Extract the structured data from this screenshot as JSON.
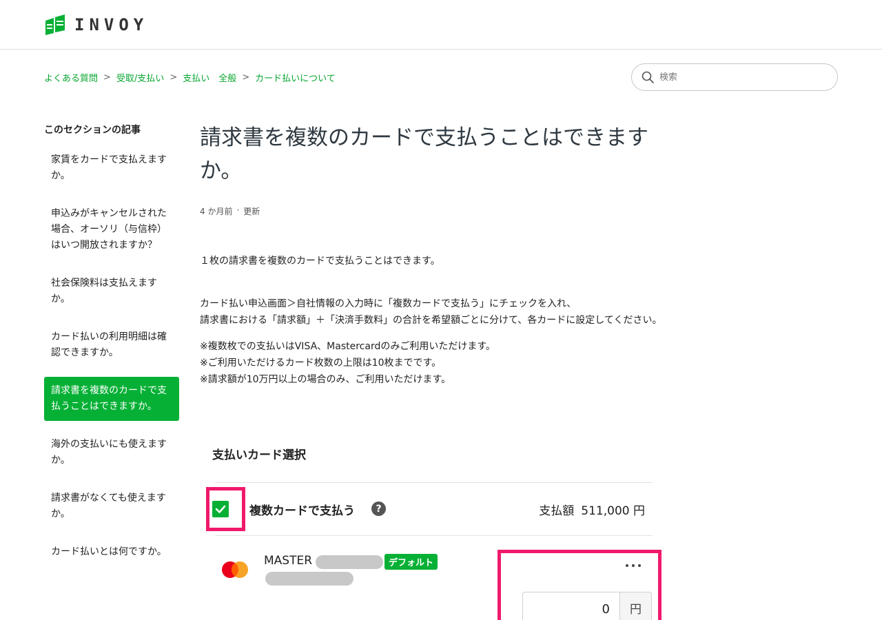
{
  "header": {
    "logo_text": "INVOY",
    "brand_color": "#06b035"
  },
  "breadcrumb": [
    "よくある質問",
    "受取/支払い",
    "支払い　全般",
    "カード払いについて"
  ],
  "search": {
    "placeholder": "検索"
  },
  "sidebar": {
    "title": "このセクションの記事",
    "items": [
      {
        "label": "家賃をカードで支払えますか。",
        "active": false
      },
      {
        "label": "申込みがキャンセルされた場合、オーソリ（与信枠）はいつ開放されますか？",
        "active": false
      },
      {
        "label": "社会保険料は支払えますか。",
        "active": false
      },
      {
        "label": "カード払いの利用明細は確認できますか。",
        "active": false
      },
      {
        "label": "請求書を複数のカードで支払うことはできますか。",
        "active": true
      },
      {
        "label": "海外の支払いにも使えますか。",
        "active": false
      },
      {
        "label": "請求書がなくても使えますか。",
        "active": false
      },
      {
        "label": "カード払いとは何ですか。",
        "active": false
      }
    ]
  },
  "article": {
    "title": "請求書を複数のカードで支払うことはできますか。",
    "meta_time": "4 か月前",
    "meta_sep": "·",
    "meta_updated": "更新",
    "p1": "１枚の請求書を複数のカードで支払うことはできます。",
    "p2_line1": "カード払い申込画面＞自社情報の入力時に「複数カードで支払う」にチェックを入れ、",
    "p2_line2": "請求書における「請求額」＋「決済手数料」の合計を希望額ごとに分けて、各カードに設定してください。",
    "notes": [
      "※複数枚での支払いはVISA、Mastercardのみご利用いただけます。",
      "※ご利用いただけるカード枚数の上限は10枚までです。",
      "※請求額が10万円以上の場合のみ、ご利用いただけます。"
    ]
  },
  "card_panel": {
    "title": "支払いカード選択",
    "multi_card_label": "複数カードで支払う",
    "help_symbol": "?",
    "amount_label": "支払額",
    "amount_value": "511,000 円",
    "card_name": "MASTER",
    "default_badge": "デフォルト",
    "input_value": "0",
    "input_unit": "円",
    "highlight_color": "#f0196c"
  }
}
